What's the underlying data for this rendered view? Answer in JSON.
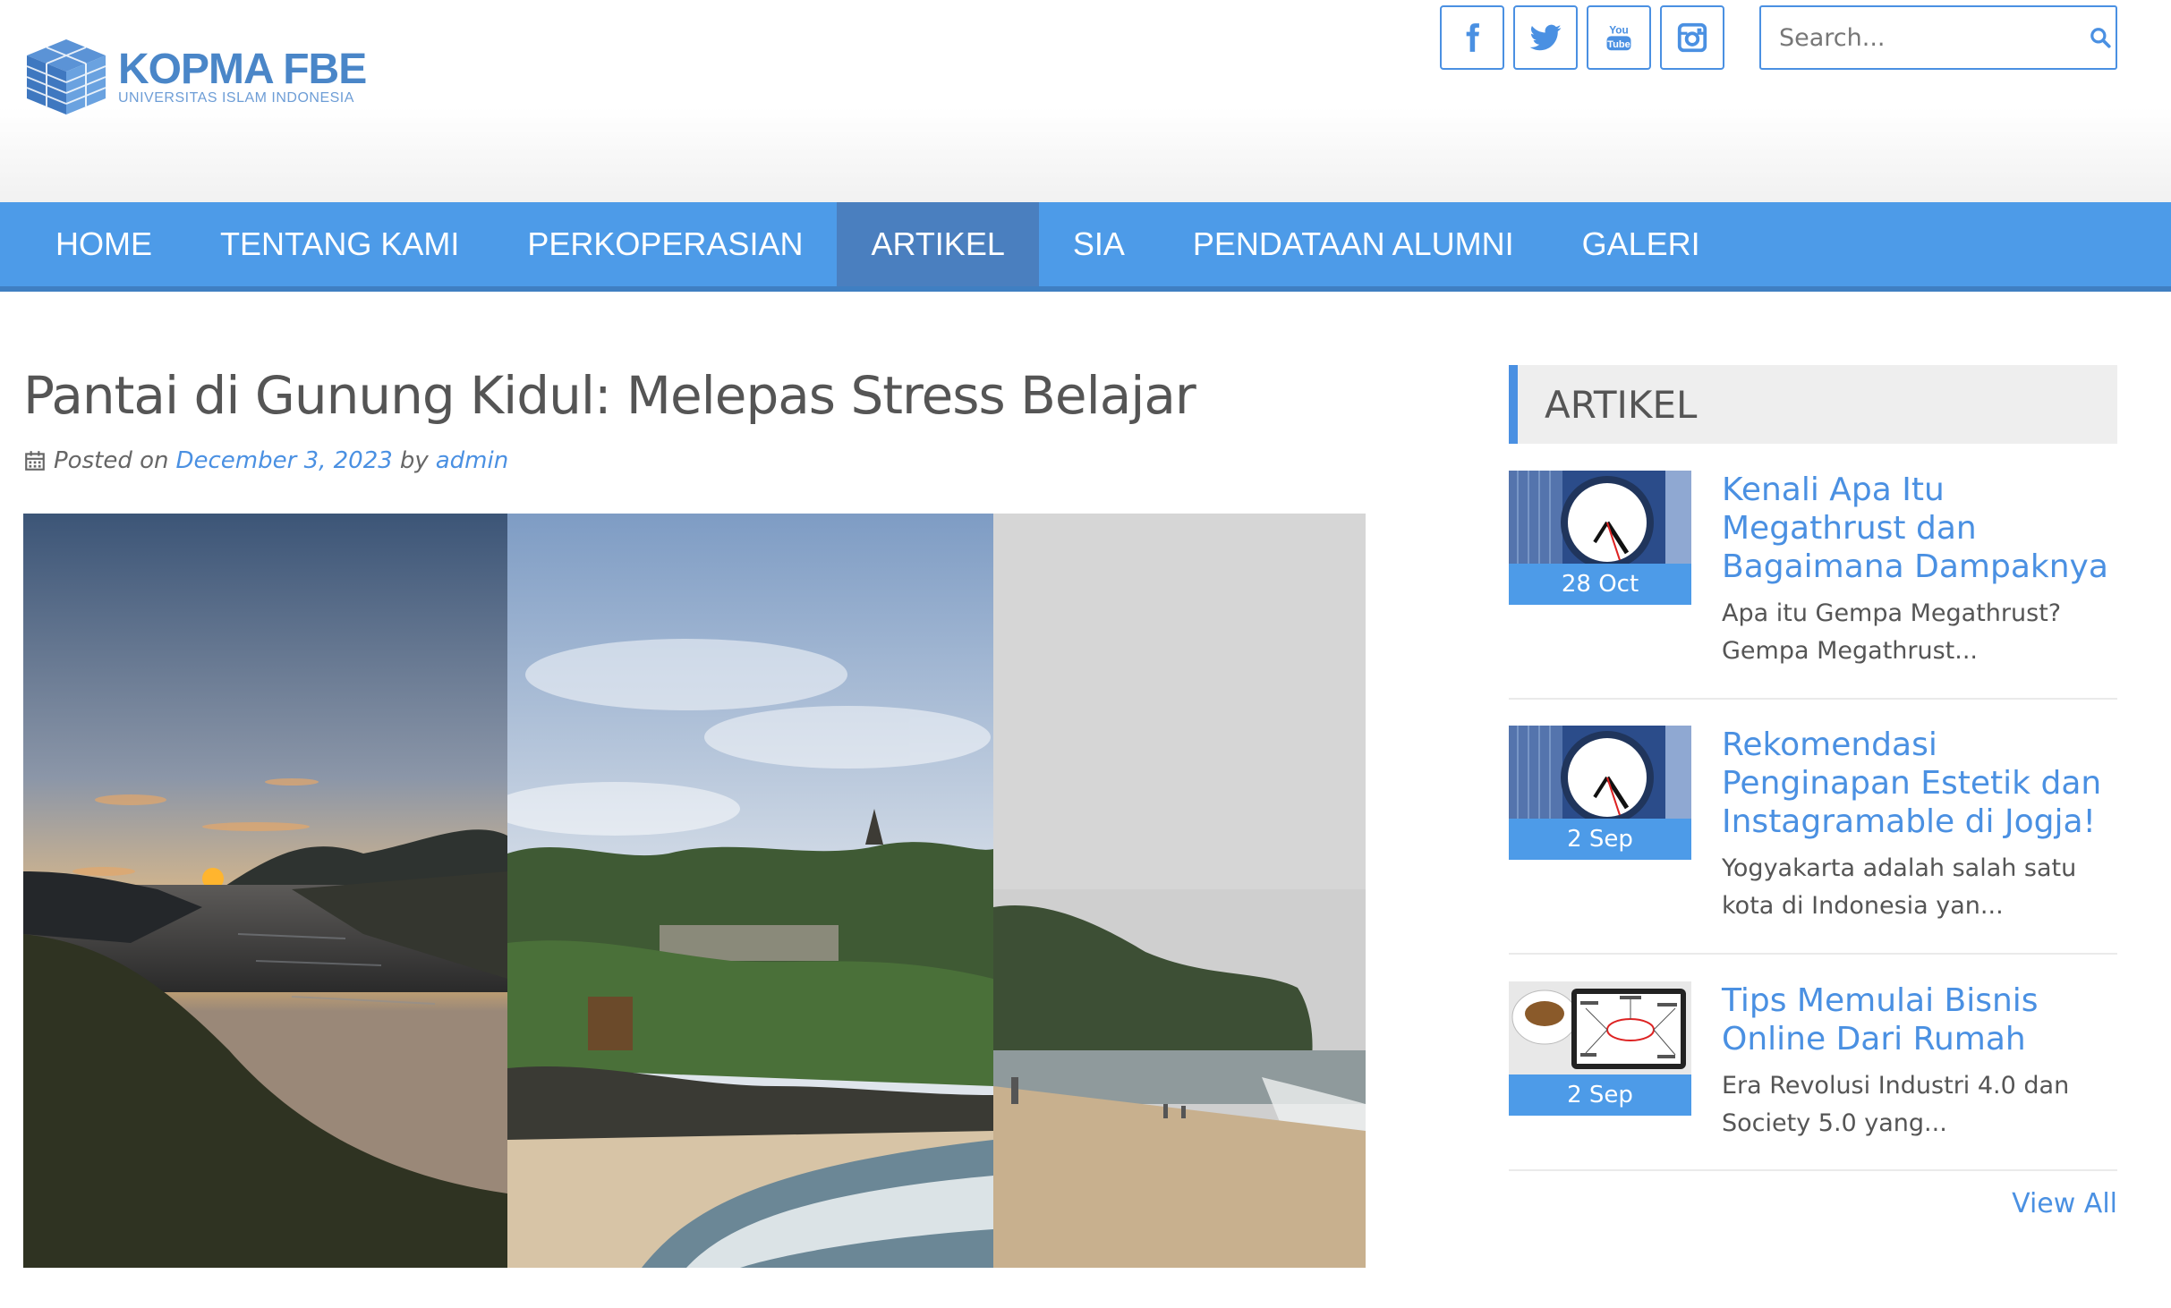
{
  "header": {
    "logo_title": "KOPMA FBE",
    "logo_subtitle": "UNIVERSITAS ISLAM INDONESIA",
    "social": [
      "facebook-icon",
      "twitter-icon",
      "youtube-icon",
      "instagram-icon"
    ],
    "youtube_text_top": "You",
    "youtube_text_bottom": "Tube",
    "search_placeholder": "Search..."
  },
  "nav": {
    "items": [
      "HOME",
      "TENTANG KAMI",
      "PERKOPERASIAN",
      "ARTIKEL",
      "SIA",
      "PENDATAAN ALUMNI",
      "GALERI"
    ],
    "active": "ARTIKEL"
  },
  "post": {
    "title": "Pantai di Gunung Kidul: Melepas Stress Belajar",
    "posted_on": "Posted on",
    "date": "December 3, 2023",
    "by": "by",
    "author": "admin"
  },
  "sidebar": {
    "widget_title": "ARTIKEL",
    "articles": [
      {
        "date": "28 Oct",
        "title": "Kenali Apa Itu Megathrust dan Bagaimana Dampaknya",
        "excerpt": "Apa itu Gempa Megathrust? Gempa Megathrust...",
        "thumb": "clock-image"
      },
      {
        "date": "2 Sep",
        "title": "Rekomendasi Penginapan Estetik dan Instagramable di Jogja!",
        "excerpt": "Yogyakarta adalah salah satu kota di Indonesia yan...",
        "thumb": "clock-image"
      },
      {
        "date": "2 Sep",
        "title": "Tips Memulai Bisnis Online Dari Rumah",
        "excerpt": "Era Revolusi Industri 4.0 dan Society 5.0 yang...",
        "thumb": "digital-marketing-image"
      }
    ],
    "view_all": "View All"
  },
  "colors": {
    "accent": "#4a90e2",
    "nav_bg": "#4d9be8",
    "nav_active": "#4a7fbf",
    "text": "#555555"
  }
}
